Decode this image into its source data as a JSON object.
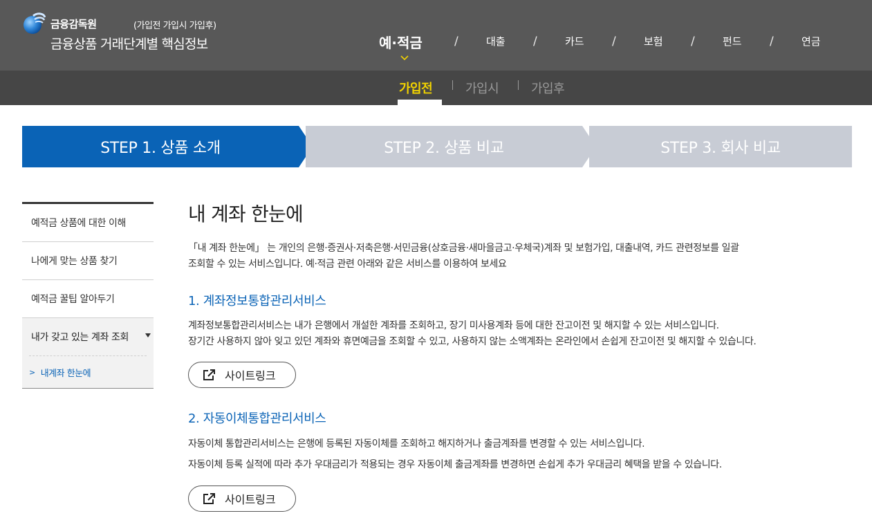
{
  "header": {
    "org_name": "금융감독원",
    "phase_note": "(가입전 가입시 가입후)",
    "site_title": "금융상품 거래단계별 핵심정보",
    "gnb": [
      "예·적금",
      "대출",
      "카드",
      "보험",
      "펀드",
      "연금"
    ],
    "gnb_separator": "/",
    "subtabs": [
      "가입전",
      "가입시",
      "가입후"
    ]
  },
  "steps": [
    "STEP 1. 상품 소개",
    "STEP 2. 상품 비교",
    "STEP 3. 회사 비교"
  ],
  "sidebar": {
    "items": [
      "예적금 상품에 대한 이해",
      "나에게 맞는 상품 찾기",
      "예적금 꿀팁 알아두기"
    ],
    "group": {
      "label": "내가 갖고 있는 계좌 조회",
      "sub_item": "내계좌 한눈에",
      "sub_chevron": ">"
    }
  },
  "main": {
    "title": "내 계좌 한눈에",
    "intro_line1": "「내 계좌 한눈에」 는 개인의 은행·증권사·저축은행·서민금융(상호금융·새마을금고·우체국)계좌 및 보험가입, 대출내역, 카드 관련정보를 일괄",
    "intro_line2": "조회할 수 있는 서비스입니다. 예·적금 관련 아래와 같은 서비스를 이용하여 보세요",
    "sections": [
      {
        "title": "1. 계좌정보통합관리서비스",
        "desc1": "계좌정보통합관리서비스는 내가 은행에서 개설한 계좌를 조회하고, 장기 미사용계좌 등에 대한 잔고이전 및 해지할 수 있는 서비스입니다.",
        "desc2": "장기간 사용하지 않아 잊고 있던 계좌와 휴면예금을 조회할 수 있고, 사용하지 않는 소액계좌는 온라인에서 손쉽게 잔고이전 및 해지할 수 있습니다.",
        "button": "사이트링크"
      },
      {
        "title": "2. 자동이체통합관리서비스",
        "desc1": "자동이체 통합관리서비스는 은행에 등록된 자동이체를 조회하고 해지하거나 출금계좌를 변경할 수 있는 서비스입니다.",
        "desc2": "자동이체 등록 실적에 따라 추가 우대금리가 적용되는 경우 자동이체 출금계좌를 변경하면 손쉽게 추가 우대금리 혜택을 받을 수 있습니다.",
        "button": "사이트링크"
      }
    ]
  },
  "colors": {
    "header_bg": "#585858",
    "subbar_bg": "#464646",
    "accent_blue": "#0a63b6",
    "active_yellow": "#f1d200",
    "step_inactive": "#c8ccd5"
  },
  "icons": [
    "fss-logo-icon",
    "chevron-down-icon",
    "external-link-icon"
  ]
}
